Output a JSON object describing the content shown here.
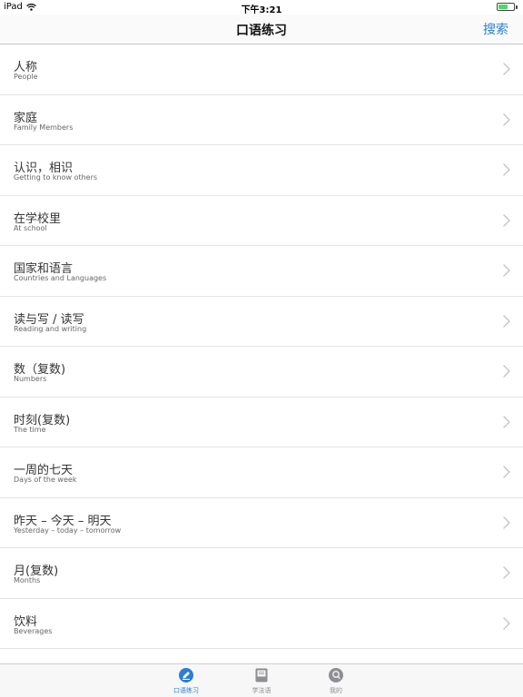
{
  "status_bar": {
    "device": "iPad",
    "time": "下午3:21",
    "battery_level": 0.65,
    "battery_color": "#4cd964"
  },
  "nav": {
    "title": "口语练习",
    "search_label": "搜索",
    "accent_color": "#2a7fd4"
  },
  "list": {
    "items": [
      {
        "title": "人称",
        "subtitle": "People"
      },
      {
        "title": "家庭",
        "subtitle": "Family Members"
      },
      {
        "title": "认识，相识",
        "subtitle": "Getting to know others"
      },
      {
        "title": "在学校里",
        "subtitle": "At school"
      },
      {
        "title": "国家和语言",
        "subtitle": "Countries and Languages"
      },
      {
        "title": "读与写 / 读写",
        "subtitle": "Reading and writing"
      },
      {
        "title": "数（复数)",
        "subtitle": "Numbers"
      },
      {
        "title": "时刻(复数)",
        "subtitle": "The time"
      },
      {
        "title": "一周的七天",
        "subtitle": "Days of the week"
      },
      {
        "title": "昨天 – 今天 – 明天",
        "subtitle": "Yesterday – today – tomorrow"
      },
      {
        "title": "月(复数)",
        "subtitle": "Months"
      },
      {
        "title": "饮料",
        "subtitle": "Beverages"
      }
    ],
    "chevron_icon": "chevron-right-icon"
  },
  "tab_bar": {
    "tabs": [
      {
        "label": "口语练习",
        "icon": "pencil-icon",
        "active": true
      },
      {
        "label": "学法语",
        "icon": "book-icon",
        "active": false
      },
      {
        "label": "我的",
        "icon": "profile-icon",
        "active": false
      }
    ]
  }
}
